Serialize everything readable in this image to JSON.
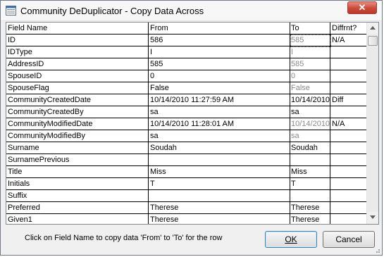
{
  "window": {
    "title": "Community DeDuplicator - Copy Data Across",
    "icons": {
      "app": "app-icon",
      "close": "close-icon"
    }
  },
  "grid": {
    "columns": [
      "Field Name",
      "From",
      "To",
      "Diffrnt?"
    ],
    "rows": [
      {
        "field": "ID",
        "from": "586",
        "to": "585",
        "diff": "N/A",
        "to_dim": true
      },
      {
        "field": "IDType",
        "from": "I",
        "to": "I",
        "diff": "",
        "to_dim": true
      },
      {
        "field": "AddressID",
        "from": "585",
        "to": "585",
        "diff": "",
        "to_dim": true
      },
      {
        "field": "SpouseID",
        "from": "0",
        "to": "0",
        "diff": "",
        "to_dim": true
      },
      {
        "field": "SpouseFlag",
        "from": "False",
        "to": "False",
        "diff": "",
        "to_dim": true
      },
      {
        "field": "CommunityCreatedDate",
        "from": "10/14/2010 11:27:59 AM",
        "to": "10/14/2010",
        "diff": "Diff",
        "to_dim": false
      },
      {
        "field": "CommunityCreatedBy",
        "from": "sa",
        "to": "sa",
        "diff": "",
        "to_dim": false
      },
      {
        "field": "CommunityModifiedDate",
        "from": "10/14/2010 11:28:01 AM",
        "to": "10/14/2010",
        "diff": "N/A",
        "to_dim": true
      },
      {
        "field": "CommunityModifiedBy",
        "from": "sa",
        "to": "sa",
        "diff": "",
        "to_dim": true
      },
      {
        "field": "Surname",
        "from": "Soudah",
        "to": "Soudah",
        "diff": "",
        "to_dim": false
      },
      {
        "field": "SurnamePrevious",
        "from": "",
        "to": "",
        "diff": "",
        "to_dim": false
      },
      {
        "field": "Title",
        "from": "Miss",
        "to": "Miss",
        "diff": "",
        "to_dim": false
      },
      {
        "field": "Initials",
        "from": "T",
        "to": "T",
        "diff": "",
        "to_dim": false
      },
      {
        "field": "Suffix",
        "from": "",
        "to": "",
        "diff": "",
        "to_dim": false
      },
      {
        "field": "Preferred",
        "from": "Therese",
        "to": "Therese",
        "diff": "",
        "to_dim": false
      },
      {
        "field": "Given1",
        "from": "Therese",
        "to": "Therese",
        "diff": "",
        "to_dim": false
      }
    ]
  },
  "footer": {
    "hint": "Click on Field Name to copy data 'From' to 'To' for the row",
    "ok_label": "OK",
    "cancel_label": "Cancel"
  }
}
